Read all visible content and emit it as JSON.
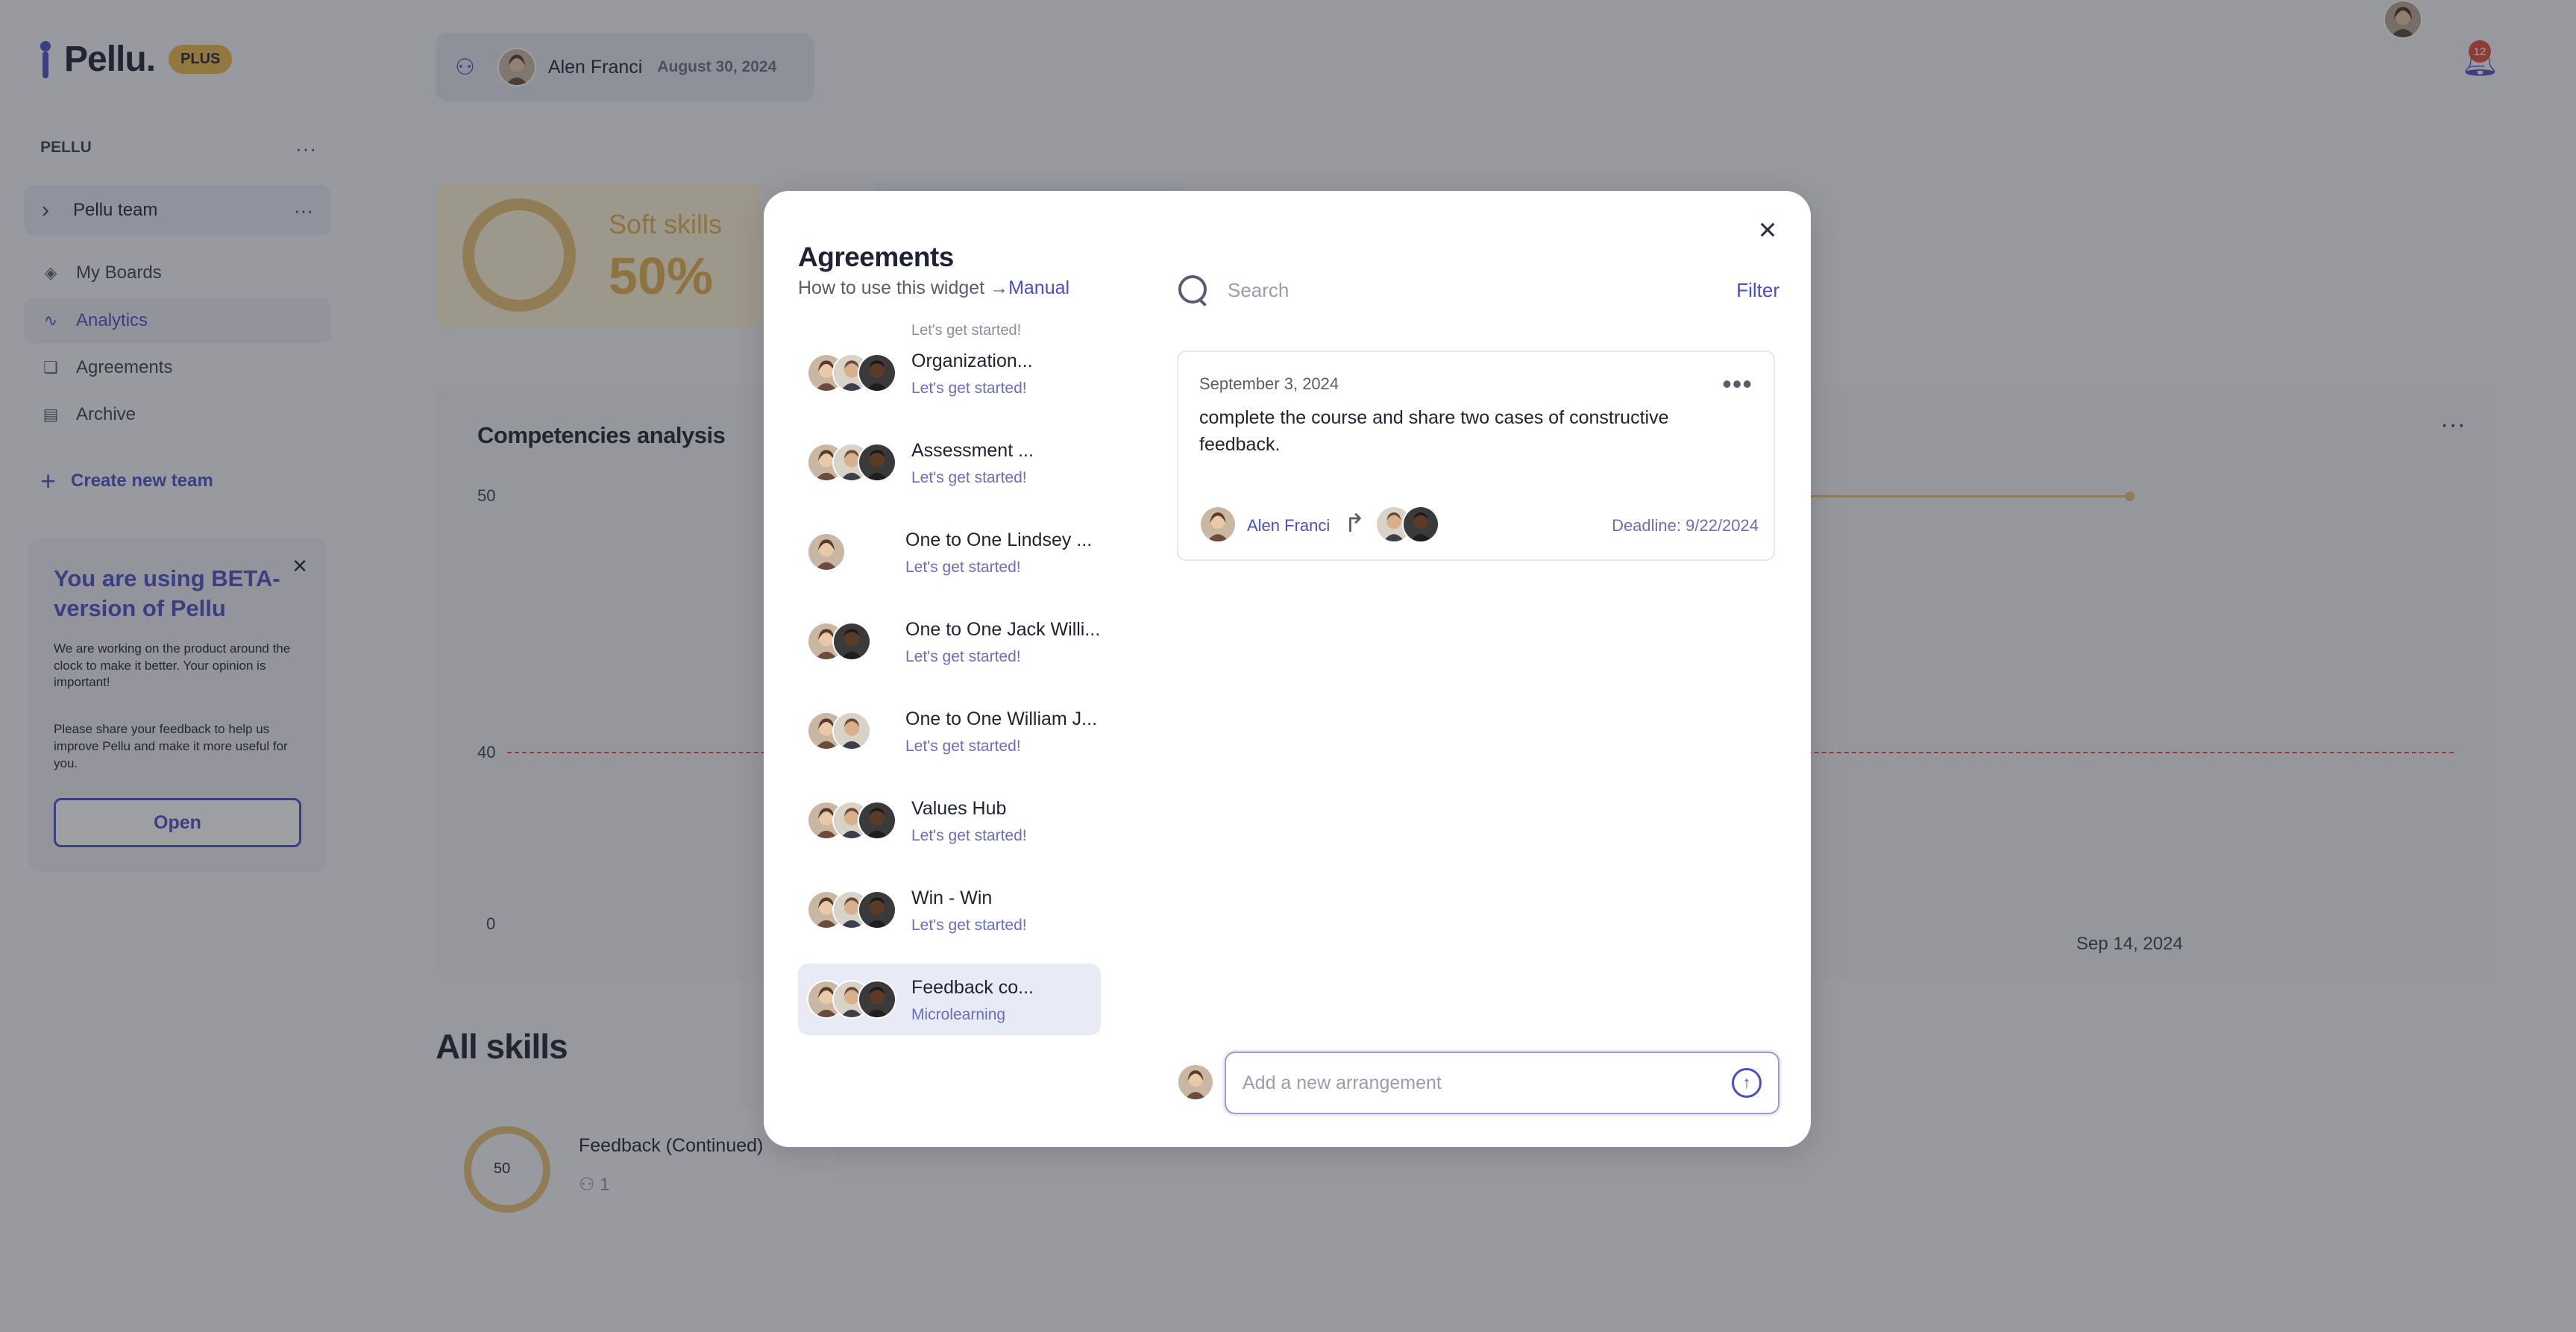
{
  "app": {
    "logo_text": "Pellu.",
    "plan_badge": "PLUS"
  },
  "sidebar": {
    "section_title": "PELLU",
    "team_name": "Pellu team",
    "items": [
      {
        "label": "My Boards",
        "icon": "boards-icon"
      },
      {
        "label": "Analytics",
        "icon": "analytics-icon",
        "active": true
      },
      {
        "label": "Agreements",
        "icon": "agreements-icon"
      },
      {
        "label": "Archive",
        "icon": "archive-icon"
      }
    ],
    "create_team_label": "Create new team",
    "beta": {
      "title": "You are using BETA-version of Pellu",
      "text1": "We are working on the product around the clock to make it better. Your opinion is important!",
      "text2": "Please share your feedback to help us improve Pellu and make it more useful for you.",
      "open_label": "Open"
    }
  },
  "header": {
    "user_name": "Alen Franci",
    "date": "August 30, 2024",
    "notifications_count": "12"
  },
  "dashboard": {
    "soft_skills_label": "Soft skills",
    "soft_skills_value": "50%",
    "competencies_title": "Competencies analysis",
    "axis_labels": [
      "50",
      "40",
      "0"
    ],
    "date_tick": "Sep 14, 2024",
    "all_skills_title": "All skills",
    "skill": {
      "value": "50",
      "name": "Feedback (Continued)",
      "members": "1"
    }
  },
  "modal": {
    "title": "Agreements",
    "help_text": "How to use this widget",
    "help_arrow": "→",
    "manual_link": "Manual",
    "cut_item_sub": "Let's get started!",
    "agreements": [
      {
        "name": "Organization...",
        "sub": "Let's get started!"
      },
      {
        "name": "Assessment ...",
        "sub": "Let's get started!"
      },
      {
        "name": "One to One Lindsey ...",
        "sub": "Let's get started!"
      },
      {
        "name": "One to One Jack Willi...",
        "sub": "Let's get started!"
      },
      {
        "name": "One to One William J...",
        "sub": "Let's get started!"
      },
      {
        "name": "Values Hub",
        "sub": "Let's get started!"
      },
      {
        "name": "Win - Win",
        "sub": "Let's get started!"
      },
      {
        "name": "Feedback co...",
        "sub": "Microlearning",
        "selected": true
      }
    ],
    "search_placeholder": "Search",
    "filter_label": "Filter",
    "card": {
      "date": "September 3, 2024",
      "text": "complete the course and share two cases of constructive feedback.",
      "owner": "Alen Franci",
      "deadline": "Deadline: 9/22/2024"
    },
    "composer_placeholder": "Add a new arrangement"
  },
  "colors": {
    "accent": "#4b4fc4",
    "gold": "#e1b04a",
    "danger": "#e04848"
  }
}
